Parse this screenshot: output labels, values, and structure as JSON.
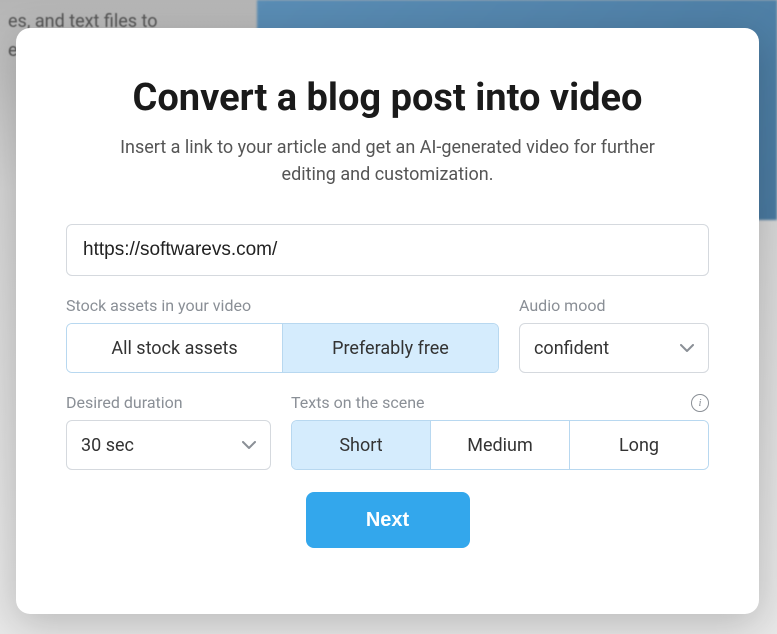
{
  "modal": {
    "title": "Convert a blog post into video",
    "subtitle": "Insert a link to your article and get an AI-generated video for further editing and customization.",
    "url_value": "https://softwarevs.com/",
    "url_placeholder": "https://",
    "next_label": "Next"
  },
  "stock": {
    "label": "Stock assets in your video",
    "options": [
      "All stock assets",
      "Preferably free"
    ],
    "selected_index": 1
  },
  "audio": {
    "label": "Audio mood",
    "selected": "confident"
  },
  "duration": {
    "label": "Desired duration",
    "selected": "30 sec"
  },
  "texts": {
    "label": "Texts on the scene",
    "options": [
      "Short",
      "Medium",
      "Long"
    ],
    "selected_index": 0
  }
}
